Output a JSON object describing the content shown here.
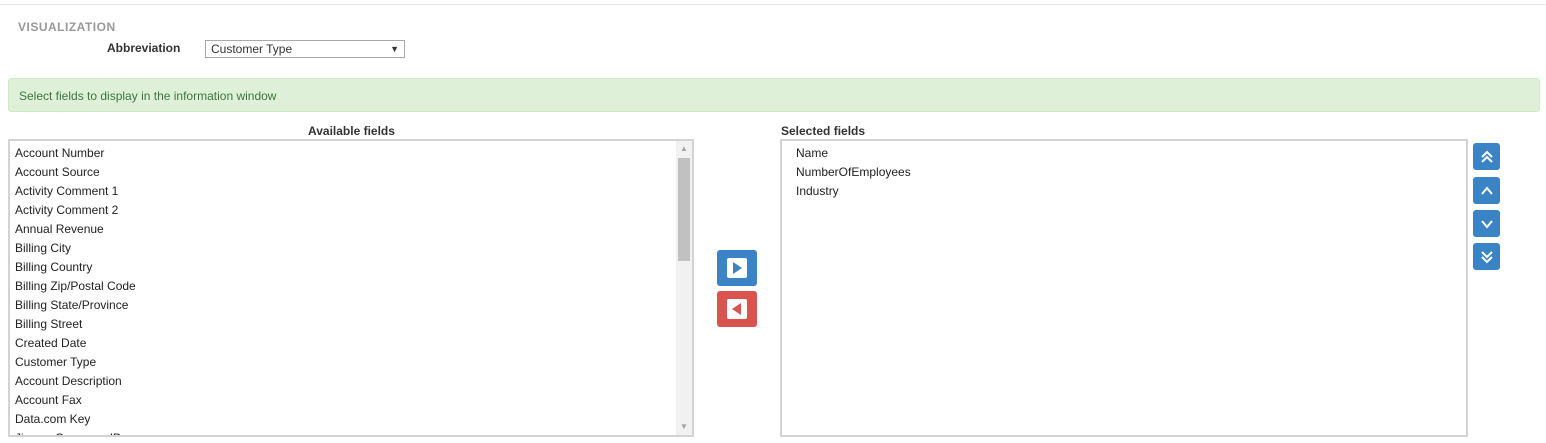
{
  "section_title": "VISUALIZATION",
  "abbreviation": {
    "label": "Abbreviation",
    "selected": "Customer Type"
  },
  "info_message": "Select fields to display in the information window",
  "available": {
    "title": "Available fields",
    "items": [
      "Account Number",
      "Account Source",
      "Activity Comment 1",
      "Activity Comment 2",
      "Annual Revenue",
      "Billing City",
      "Billing Country",
      "Billing Zip/Postal Code",
      "Billing State/Province",
      "Billing Street",
      "Created Date",
      "Customer Type",
      "Account Description",
      "Account Fax",
      "Data.com Key",
      "Jigsaw Company ID"
    ]
  },
  "selected": {
    "title": "Selected fields",
    "items": [
      "Name",
      "NumberOfEmployees",
      "Industry"
    ]
  },
  "icons": {
    "add": "move-right-icon",
    "remove": "move-left-icon",
    "top": "double-chevron-up-icon",
    "up": "chevron-up-icon",
    "down": "chevron-down-icon",
    "bottom": "double-chevron-down-icon"
  },
  "colors": {
    "primary": "#3a84c6",
    "danger": "#d9534f",
    "info_bg": "#dff0d8",
    "info_text": "#3c763d"
  }
}
